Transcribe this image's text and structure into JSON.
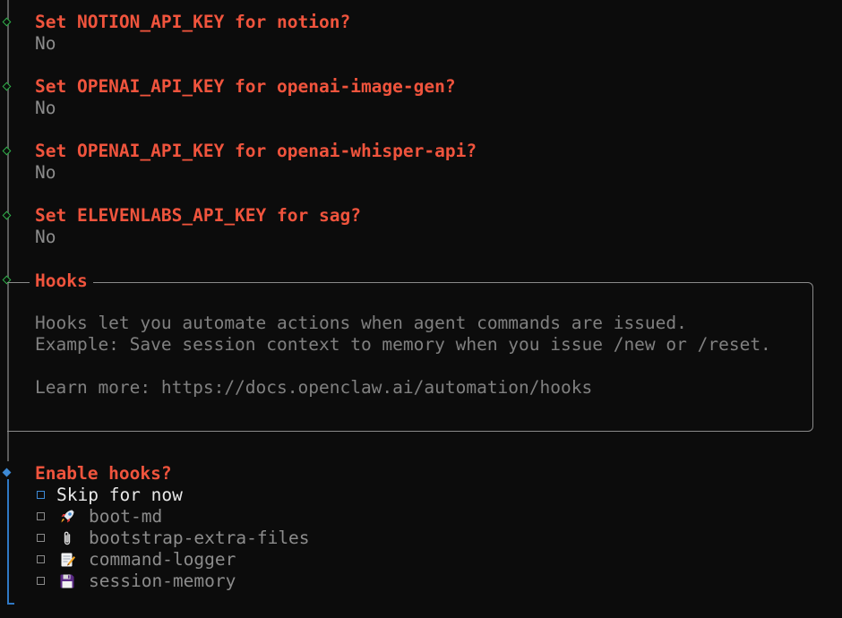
{
  "completed_prompts": [
    {
      "question": "Set NOTION_API_KEY for notion?",
      "answer": "No"
    },
    {
      "question": "Set OPENAI_API_KEY for openai-image-gen?",
      "answer": "No"
    },
    {
      "question": "Set OPENAI_API_KEY for openai-whisper-api?",
      "answer": "No"
    },
    {
      "question": "Set ELEVENLABS_API_KEY for sag?",
      "answer": "No"
    }
  ],
  "hooks_note": {
    "title": "Hooks",
    "line1": "Hooks let you automate actions when agent commands are issued.",
    "line2": "Example: Save session context to memory when you issue /new or /reset.",
    "learn_more": "Learn more: https://docs.openclaw.ai/automation/hooks"
  },
  "active_prompt": {
    "question": "Enable hooks?",
    "options": [
      {
        "label": "Skip for now",
        "icon": "",
        "state": "cursor"
      },
      {
        "label": "boot-md",
        "icon": "rocket-icon",
        "state": "unchecked"
      },
      {
        "label": "bootstrap-extra-files",
        "icon": "paperclip-icon",
        "state": "unchecked"
      },
      {
        "label": "command-logger",
        "icon": "memo-icon",
        "state": "unchecked"
      },
      {
        "label": "session-memory",
        "icon": "floppy-disk-icon",
        "state": "unchecked"
      }
    ]
  },
  "colors": {
    "question": "#f0543d",
    "answer": "#8c8c8c",
    "done_marker": "#2fb24a",
    "active_marker": "#3d8ad6",
    "background": "#0c0c0c"
  }
}
